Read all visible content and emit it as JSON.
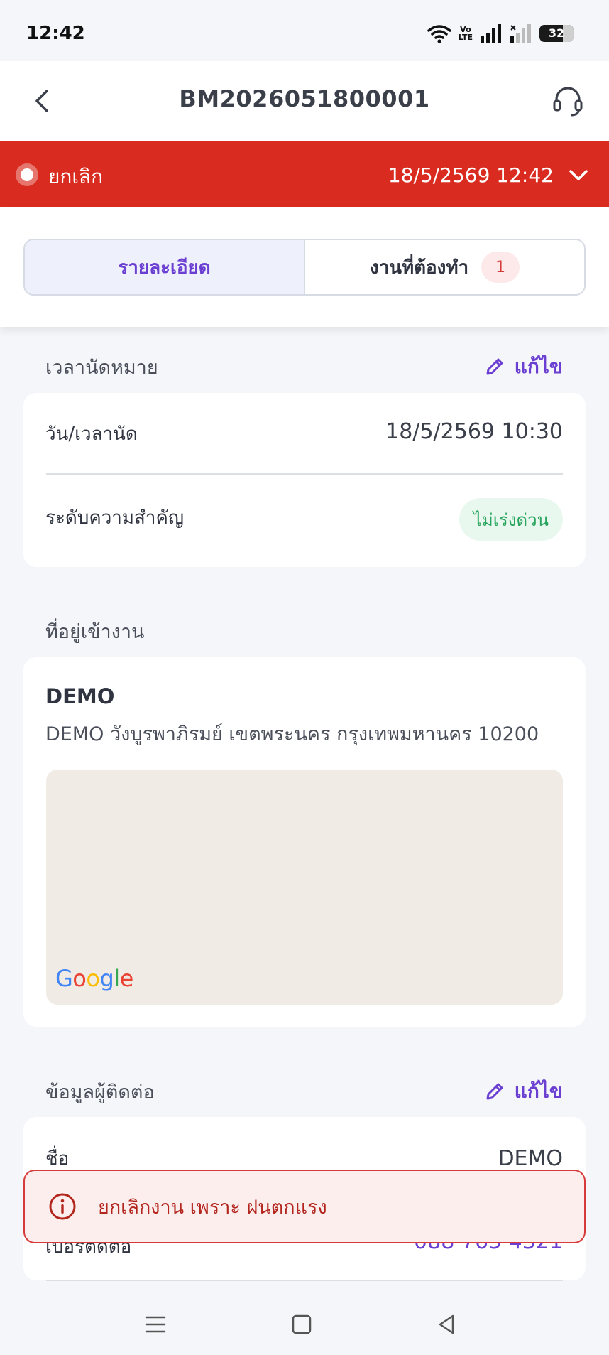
{
  "status_bar": {
    "time": "12:42",
    "volte": "Vo\nLTE",
    "battery": "32"
  },
  "header": {
    "title": "BM2026051800001"
  },
  "status_banner": {
    "label": "ยกเลิก",
    "datetime": "18/5/2569 12:42",
    "color": "#d92b1f"
  },
  "tabs": [
    {
      "label": "รายละเอียด",
      "active": true
    },
    {
      "label": "งานที่ต้องทำ",
      "badge": "1",
      "active": false
    }
  ],
  "appointment": {
    "section_title": "เวลานัดหมาย",
    "edit_label": "แก้ไข",
    "rows": [
      {
        "label": "วัน/เวลานัด",
        "value": "18/5/2569 10:30"
      },
      {
        "label": "ระดับความสำคัญ",
        "value": "ไม่เร่งด่วน"
      }
    ]
  },
  "address": {
    "section_title": "ที่อยู่เข้างาน",
    "name": "DEMO",
    "full": "DEMO วังบูรพาภิรมย์ เขตพระนคร กรุงเทพมหานคร 10200",
    "map_brand": "Google"
  },
  "contact": {
    "section_title": "ข้อมูลผู้ติดต่อ",
    "edit_label": "แก้ไข",
    "rows": [
      {
        "label": "ชื่อ",
        "value": "DEMO"
      },
      {
        "label": "เบอร์ติดต่อ",
        "value": "088 765 4321"
      }
    ]
  },
  "toast": {
    "message": "ยกเลิกงาน เพราะ ฝนตกแรง"
  },
  "colors": {
    "accent": "#6b3fd1",
    "danger": "#d92b1f",
    "success": "#28a45d"
  }
}
